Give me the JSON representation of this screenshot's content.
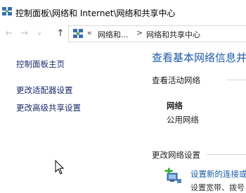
{
  "window": {
    "title": "控制面板\\网络和 Internet\\网络和共享中心"
  },
  "navigation": {
    "back_icon": "←",
    "forward_icon": "→",
    "recent_icon": "∨",
    "up_icon": "↑",
    "chevron": "«",
    "separator": ">",
    "breadcrumbs": [
      "网络和...",
      "网络和共享中心"
    ]
  },
  "left_pane": {
    "links": [
      "控制面板主页",
      "更改适配器设置",
      "更改高级共享设置"
    ]
  },
  "main": {
    "title": "查看基本网络信息并",
    "active_networks": {
      "heading": "查看活动网络",
      "network_name": "网络",
      "network_type": "公用网络"
    },
    "change_settings": {
      "heading": "更改网络设置",
      "tasks": [
        {
          "label": "设置新的连接或",
          "description": "设置宽带、拨号"
        }
      ]
    }
  },
  "colors": {
    "link": "#1a2a6c",
    "title_blue": "#1e5aa8"
  }
}
